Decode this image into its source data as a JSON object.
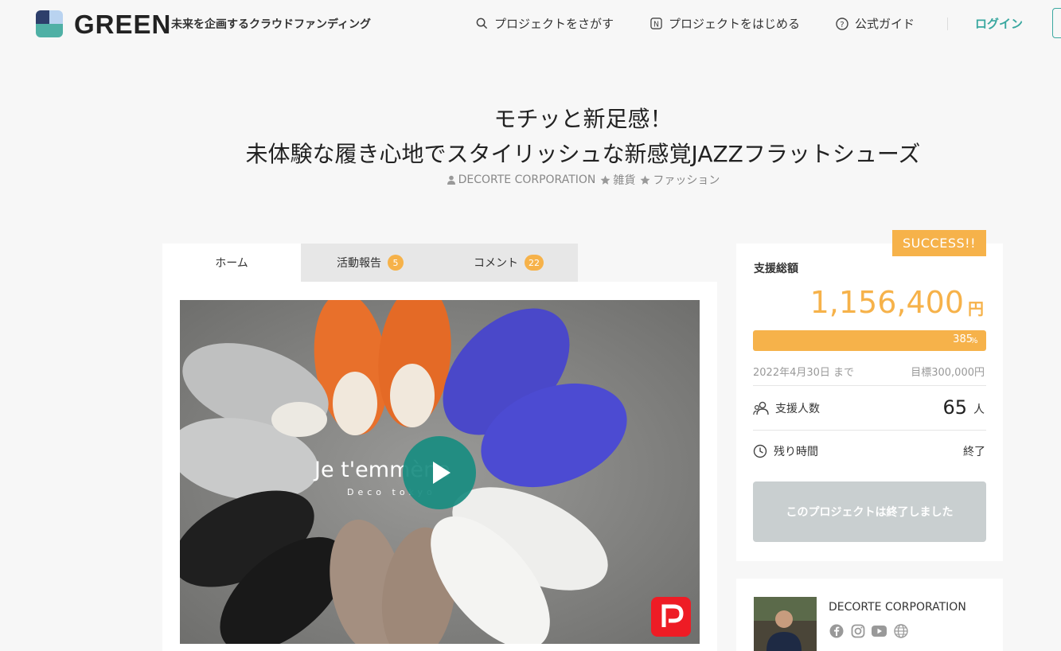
{
  "header": {
    "logo_text": "GREEN",
    "tagline": "未来を企画するクラウドファンディング",
    "nav": {
      "search": "プロジェクトをさがす",
      "start": "プロジェクトをはじめる",
      "guide": "公式ガイド"
    },
    "login": "ログイン"
  },
  "project": {
    "title_line1": "モチッと新足感！",
    "title_line2": "未体験な履き心地でスタイリッシュな新感覚JAZZフラットシューズ",
    "owner": "DECORTE CORPORATION",
    "category1": "雑貨",
    "category2": "ファッション"
  },
  "tabs": [
    {
      "label": "ホーム"
    },
    {
      "label": "活動報告",
      "count": "5"
    },
    {
      "label": "コメント",
      "count": "22"
    }
  ],
  "hero": {
    "brand": "Je t'emmène",
    "sub": "Deco tokyo"
  },
  "stats": {
    "success_badge": "SUCCESS!!",
    "total_label": "支援総額",
    "total_amount": "1,156,400",
    "currency": "円",
    "progress_pct": "385",
    "progress_unit": "%",
    "progress_fraction": 1.0,
    "deadline": "2022年4月30日 まで",
    "goal": "目標300,000円",
    "backers_label": "支援人数",
    "backers_value": "65",
    "backers_unit": "人",
    "remaining_label": "残り時間",
    "remaining_value": "終了",
    "ended_button": "このプロジェクトは終了しました"
  },
  "owner_card": {
    "name": "DECORTE CORPORATION"
  },
  "colors": {
    "accent": "#f6b24a",
    "teal": "#3aa8a0"
  }
}
